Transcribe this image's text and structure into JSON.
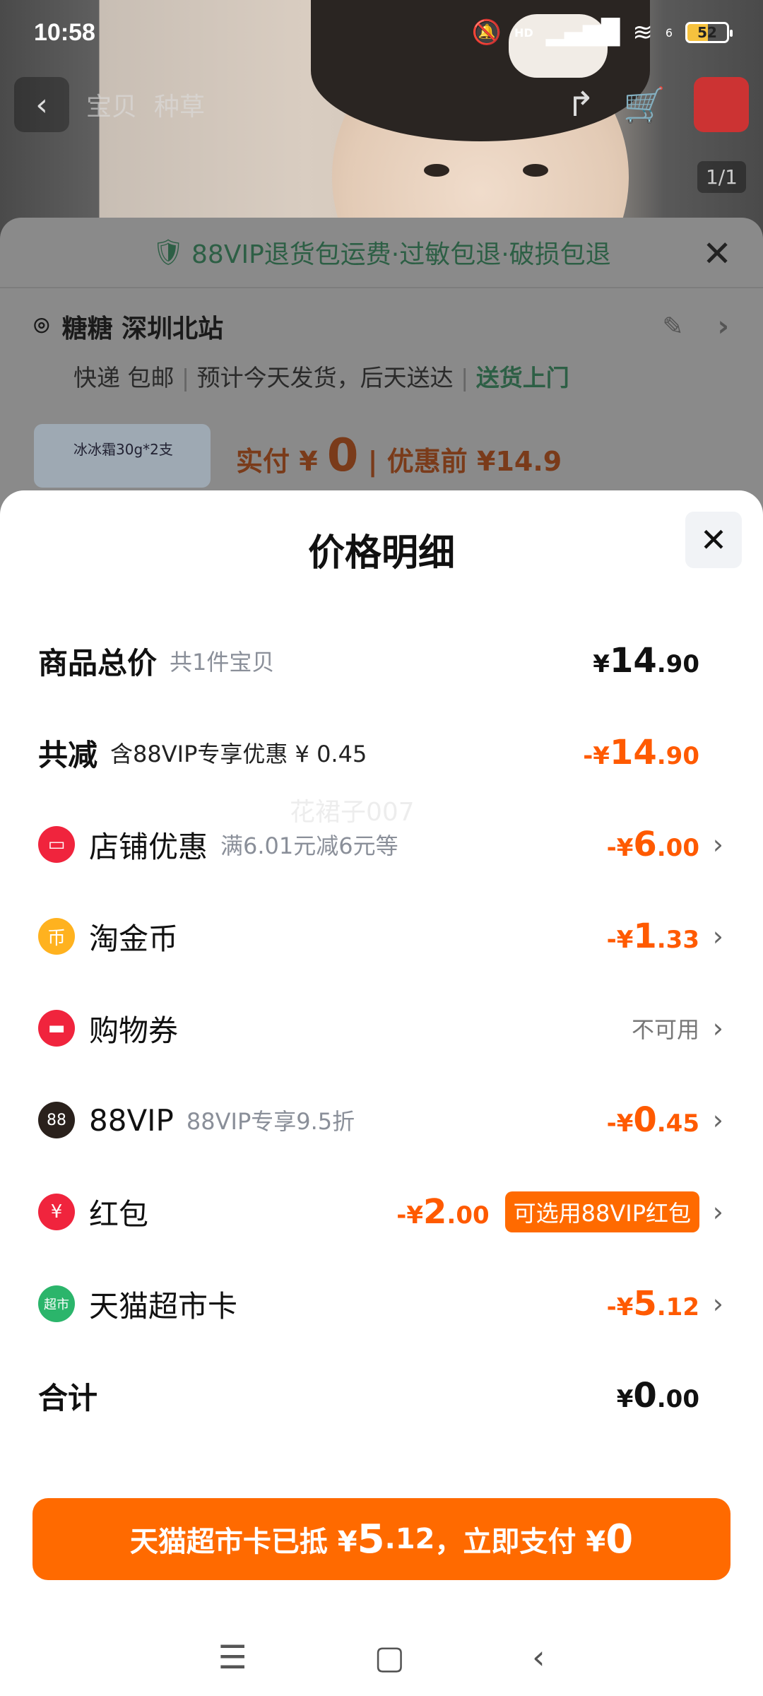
{
  "status_bar": {
    "time": "10:58",
    "hd_label": "HD",
    "signal_label": "6",
    "battery": "52"
  },
  "background": {
    "tabs": [
      "宝贝",
      "种草"
    ],
    "image_counter": "1/1",
    "banner_text": "88VIP退货包运费·过敏包退·破损包退",
    "address_name": "糖糖 深圳北站",
    "delivery_method": "快递 包邮",
    "delivery_eta": "预计今天发货，后天送达",
    "delivery_door": "送货上门",
    "product_thumb_text": "冰冰霜30g*2支",
    "actual_pay_label": "实付 ¥",
    "actual_pay_value": "0",
    "before_discount": "优惠前 ¥14.9"
  },
  "modal": {
    "title": "价格明细",
    "rows": [
      {
        "label": "商品总价",
        "sub": "共1件宝贝",
        "amount_prefix": "¥",
        "amount_int": "14",
        "amount_dec": ".90"
      },
      {
        "label": "共减",
        "sub": "含88VIP专享优惠 ¥ 0.45",
        "amount_prefix": "-¥",
        "amount_int": "14",
        "amount_dec": ".90"
      },
      {
        "label": "店铺优惠",
        "sub": "满6.01元减6元等",
        "icon": "shop-coupon-icon",
        "icon_color": "#f0243d",
        "amount_prefix": "-¥",
        "amount_int": "6",
        "amount_dec": ".00"
      },
      {
        "label": "淘金币",
        "icon": "gold-coin-icon",
        "icon_color": "#ffb21f",
        "icon_glyph": "币",
        "amount_prefix": "-¥",
        "amount_int": "1",
        "amount_dec": ".33"
      },
      {
        "label": "购物券",
        "icon": "shopping-voucher-icon",
        "icon_color": "#f0243d",
        "status": "不可用"
      },
      {
        "label": "88VIP",
        "sub": "88VIP专享9.5折",
        "icon": "vip88-icon",
        "icon_color": "#2a211c",
        "icon_glyph": "88",
        "amount_prefix": "-¥",
        "amount_int": "0",
        "amount_dec": ".45"
      },
      {
        "label": "红包",
        "icon": "red-packet-icon",
        "icon_color": "#f0243d",
        "icon_glyph": "¥",
        "amount_prefix": "-¥",
        "amount_int": "2",
        "amount_dec": ".00",
        "tag": "可选用88VIP红包"
      },
      {
        "label": "天猫超市卡",
        "icon": "tmall-supermarket-card-icon",
        "icon_color": "#2bb56b",
        "icon_glyph": "超市",
        "amount_prefix": "-¥",
        "amount_int": "5",
        "amount_dec": ".12"
      },
      {
        "label": "合计",
        "amount_prefix": "¥",
        "amount_int": "0",
        "amount_dec": ".00"
      }
    ],
    "watermark": "花裙子007",
    "pay_button": {
      "prefix": "天猫超市卡已抵 ¥",
      "card_int": "5",
      "card_dec": ".12",
      "middle": "，立即支付 ¥",
      "pay_int": "0"
    }
  },
  "colors": {
    "accent": "#ff6a00",
    "discount_text": "#ff5a00",
    "vip_green": "#2d5f45"
  }
}
